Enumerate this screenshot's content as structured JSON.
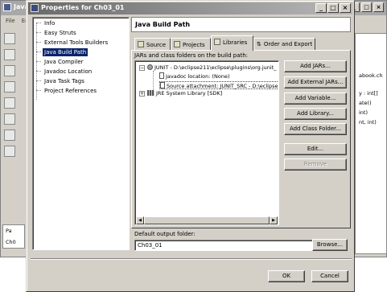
{
  "background_window": {
    "title": "Java",
    "menu": [
      "File",
      "Ed"
    ],
    "right_panel_lines": [
      "abook.ch",
      "y : int[]",
      "ate()",
      "int)",
      "nt, int)"
    ],
    "bottom_tab": "Pa",
    "status": "Ch0"
  },
  "dialog": {
    "title": "Properties for Ch03_01",
    "window_buttons": [
      "_",
      "□",
      "×"
    ],
    "nav_items": [
      "Info",
      "Easy Struts",
      "External Tools Builders",
      "Java Build Path",
      "Java Compiler",
      "Javadoc Location",
      "Java Task Tags",
      "Project References"
    ],
    "selected_nav_index": 3,
    "page_title": "Java Build Path",
    "tabs": [
      "Source",
      "Projects",
      "Libraries",
      "Order and Export"
    ],
    "active_tab_index": 2,
    "list_label": "JARs and class folders on the build path:",
    "libraries": [
      {
        "expander": "−",
        "label": "JUNIT - D:\\eclipse211\\eclipse\\plugins\\org.junit_"
      },
      {
        "expander": "",
        "label": "Javadoc location: (None)"
      },
      {
        "expander": "",
        "label": "Source attachment: JUNIT_SRC - D:\\eclipse"
      },
      {
        "expander": "+",
        "label": "JRE System Library [SDK]"
      }
    ],
    "side_buttons": {
      "add_jars": "Add JARs...",
      "add_external_jars": "Add External JARs...",
      "add_variable": "Add Variable...",
      "add_library": "Add Library...",
      "add_class_folder": "Add Class Folder...",
      "edit": "Edit...",
      "remove": "Remove"
    },
    "output_label": "Default output folder:",
    "output_value": "Ch03_01",
    "browse": "Browse...",
    "ok": "OK",
    "cancel": "Cancel"
  },
  "icons": {
    "tab_source": "folder-icon",
    "tab_projects": "projects-icon",
    "tab_libraries": "library-icon",
    "tab_order": "order-arrows-icon"
  }
}
